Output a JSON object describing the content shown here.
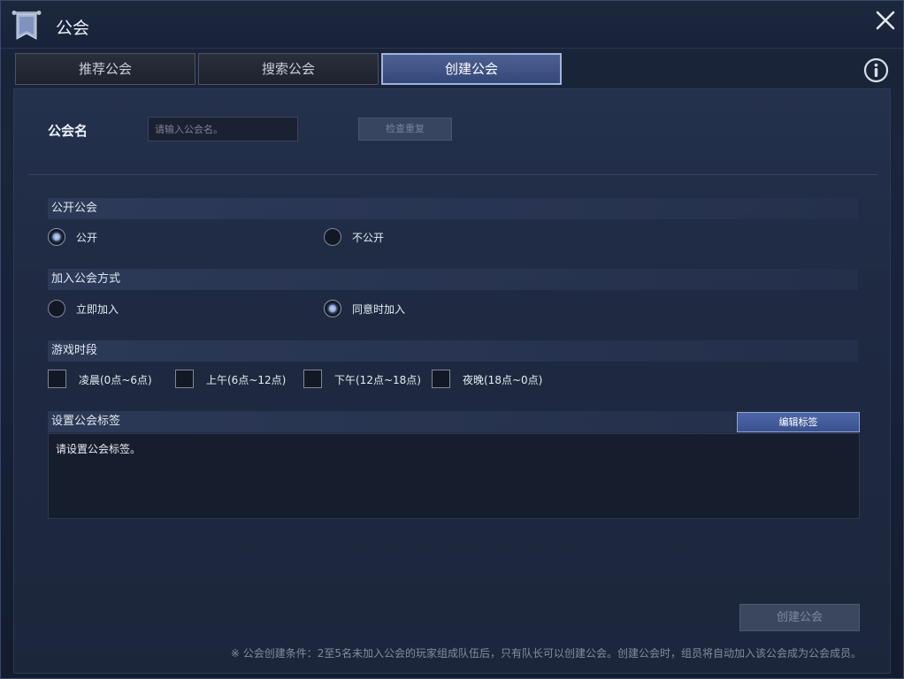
{
  "window": {
    "title": "公会"
  },
  "tabs": [
    {
      "label": "推荐公会",
      "active": false
    },
    {
      "label": "搜索公会",
      "active": false
    },
    {
      "label": "创建公会",
      "active": true
    }
  ],
  "guild_name": {
    "label": "公会名",
    "input_value": "",
    "input_placeholder": "请输入公会名。",
    "check_button": "检查重复"
  },
  "visibility": {
    "header": "公开公会",
    "options": [
      {
        "label": "公开",
        "selected": true
      },
      {
        "label": "不公开",
        "selected": false
      }
    ]
  },
  "join_method": {
    "header": "加入公会方式",
    "options": [
      {
        "label": "立即加入",
        "selected": false
      },
      {
        "label": "同意时加入",
        "selected": true
      }
    ]
  },
  "play_time": {
    "header": "游戏时段",
    "options": [
      {
        "label": "凌晨(0点~6点)",
        "checked": false
      },
      {
        "label": "上午(6点~12点)",
        "checked": false
      },
      {
        "label": "下午(12点~18点)",
        "checked": false
      },
      {
        "label": "夜晚(18点~0点)",
        "checked": false
      }
    ]
  },
  "tags": {
    "header": "设置公会标签",
    "edit_button": "编辑标签",
    "content": "请设置公会标签。"
  },
  "create_button": "创建公会",
  "footnote": "※ 公会创建条件：2至5名未加入公会的玩家组成队伍后，只有队长可以创建公会。创建公会时，组员将自动加入该公会成为公会成员。",
  "colors": {
    "accent": "#3a5290",
    "active_tab": "#34477a",
    "background": "#1c263b",
    "disabled_button": "#3a475f"
  },
  "icons": {
    "title": "banner-icon",
    "close": "close-icon",
    "info": "info-icon"
  }
}
